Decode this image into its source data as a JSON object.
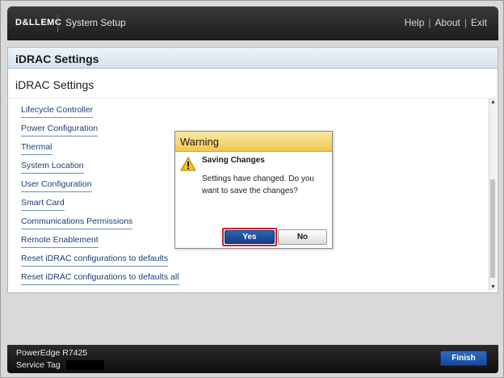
{
  "header": {
    "logo": "D&LLEMC",
    "app_title": "System Setup",
    "links": [
      "Help",
      "About",
      "Exit"
    ],
    "separator": "|"
  },
  "panel": {
    "title": "iDRAC Settings",
    "section_title": "iDRAC Settings",
    "menu_items": [
      "Lifecycle Controller",
      "Power Configuration",
      "Thermal",
      "System Location",
      "User Configuration",
      "Smart Card",
      "Communications Permissions",
      "Remote Enablement",
      "Reset iDRAC configurations to defaults",
      "Reset iDRAC configurations to defaults all"
    ]
  },
  "dialog": {
    "title": "Warning",
    "heading": "Saving Changes",
    "message": "Settings have changed. Do you want to save the changes?",
    "yes_label": "Yes",
    "no_label": "No",
    "icon": "warning-icon"
  },
  "footer": {
    "model": "PowerEdge R7425",
    "service_tag_label": "Service Tag",
    "finish_label": "Finish"
  },
  "colors": {
    "header_bg": "#1c1c1c",
    "dialog_title_bg": "#f0c84e",
    "primary_button": "#153f86",
    "focus_ring": "#c8202f",
    "link_color": "#1a3f7a"
  }
}
